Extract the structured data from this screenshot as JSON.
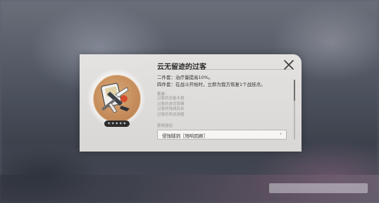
{
  "dialog": {
    "title": "云无留迹的过客",
    "close_icon": "close-icon",
    "rarity_stars": "✦✦✦✦✦",
    "bonus_two_piece": "二件套：治疗量提高10%。",
    "bonus_four_piece": "四件套：在战斗开始时，立即为我方恢复1个战技点。",
    "set_pieces_label": "套装：",
    "set_pieces": [
      "过客的逢春木簪",
      "过客的游龙臂鞲",
      "过客的残绣风衣",
      "过客的冥途游履"
    ],
    "source_label": "获得途径",
    "source_button": "侵蚀隧洞［残响回廊］",
    "source_chevron": "›"
  },
  "colors": {
    "panel_bg": "#e8e6e4",
    "icon_bg": "#c58c5b",
    "text_primary": "#2e2e2e",
    "text_muted": "#9a9a9a"
  }
}
